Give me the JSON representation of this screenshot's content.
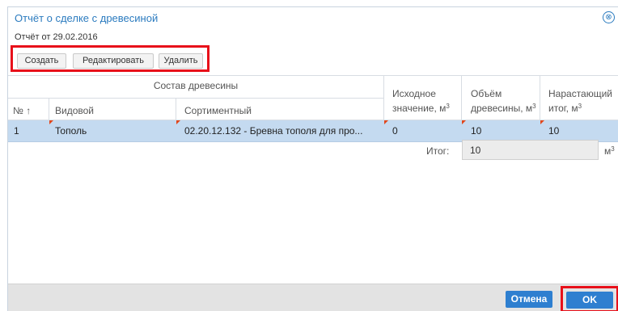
{
  "dialog": {
    "title": "Отчёт о сделке с древесиной",
    "close_icon": "⊗",
    "subtitle": "Отчёт от 29.02.2016"
  },
  "toolbar": {
    "create_label": "Создать",
    "edit_label": "Редактировать",
    "delete_label": "Удалить"
  },
  "table": {
    "group_header": "Состав древесины",
    "columns": {
      "num": "№ ↑",
      "vid": "Видовой",
      "sort": "Сортиментный",
      "init_l1": "Исходное",
      "init_l2": "значение, м",
      "vol_l1": "Объём",
      "vol_l2": "древесины, м",
      "cum_l1": "Нарастающий",
      "cum_l2": "итог, м",
      "unit_sup": "3"
    },
    "rows": [
      {
        "num": "1",
        "vid": "Тополь",
        "sort": "02.20.12.132 - Бревна тополя для про...",
        "init": "0",
        "vol": "10",
        "cum": "10"
      }
    ]
  },
  "total": {
    "label": "Итог:",
    "value": "10",
    "unit": "м",
    "unit_sup": "3"
  },
  "footer": {
    "cancel_label": "Отмена",
    "ok_label": "OK"
  },
  "colors": {
    "accent": "#2e7fd0",
    "highlight_frame": "#e8101a",
    "selected_row": "#c4daf0"
  }
}
